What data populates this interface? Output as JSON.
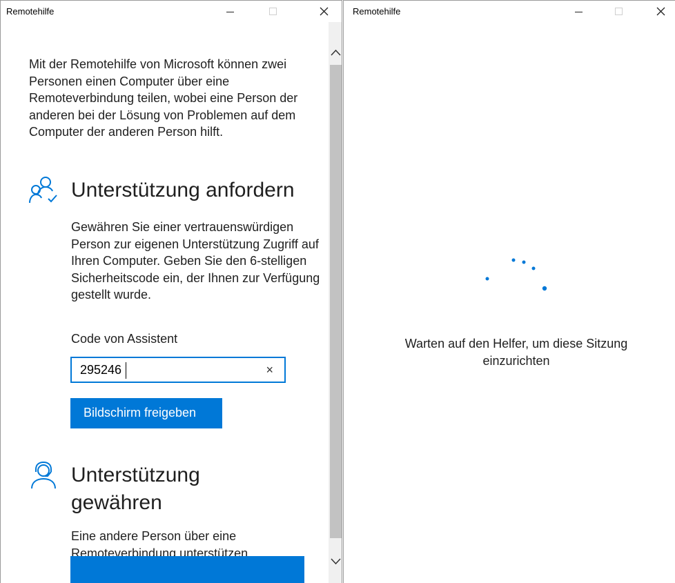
{
  "left_window": {
    "title": "Remotehilfe",
    "intro": "Mit der Remotehilfe von Microsoft können zwei Personen einen Computer über eine Remoteverbindung teilen, wobei eine Person der anderen bei der Lösung von Problemen auf dem Computer der anderen Person hilft.",
    "request_section": {
      "heading": "Unterstützung anfordern",
      "description": "Gewähren Sie einer vertrauenswürdigen Person zur eigenen Unterstützung Zugriff auf Ihren Computer. Geben Sie den 6-stelligen Sicherheitscode ein, der Ihnen zur Verfügung gestellt wurde.",
      "code_label": "Code von Assistent",
      "code_value": "295246",
      "clear_glyph": "×",
      "share_button": "Bildschirm freigeben"
    },
    "give_section": {
      "heading": "Unterstützung gewähren",
      "description": "Eine andere Person über eine Remoteverbindung unterstützen"
    }
  },
  "right_window": {
    "title": "Remotehilfe",
    "status": "Warten auf den Helfer, um diese Sitzung einzurichten"
  },
  "colors": {
    "accent": "#0078d7"
  }
}
